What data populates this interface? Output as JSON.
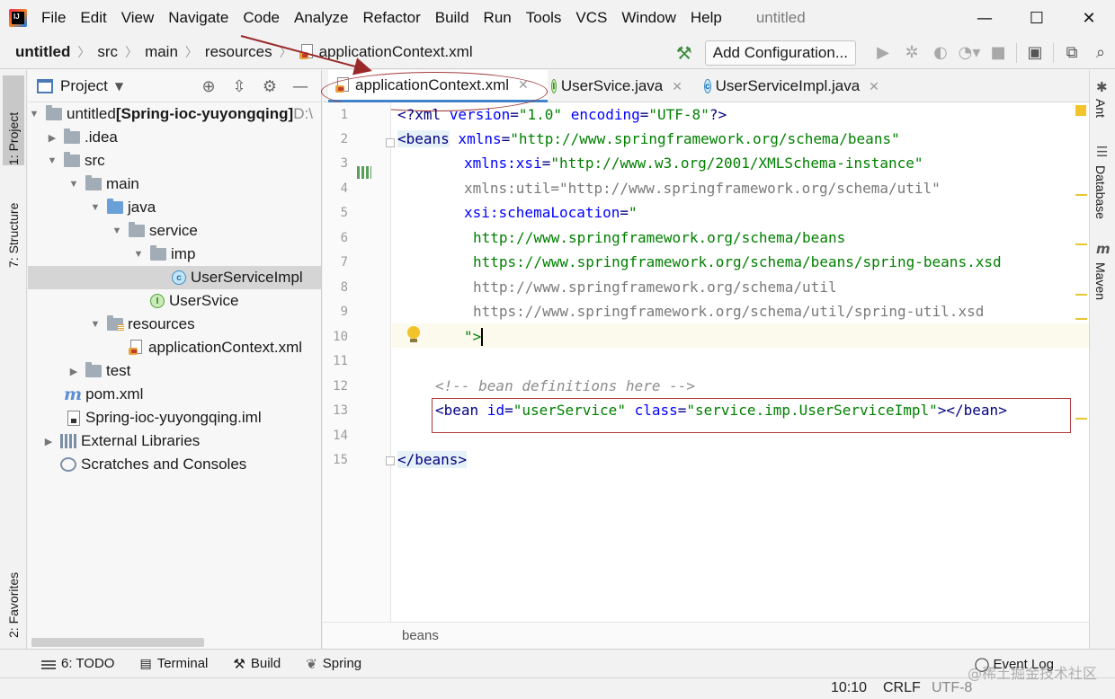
{
  "menubar": {
    "items": [
      "File",
      "Edit",
      "View",
      "Navigate",
      "Code",
      "Analyze",
      "Refactor",
      "Build",
      "Run",
      "Tools",
      "VCS",
      "Window",
      "Help"
    ],
    "window_title": "untitled",
    "minimize": "—",
    "maximize": "☐",
    "close": "✕"
  },
  "navbar": {
    "crumbs": [
      "untitled",
      "src",
      "main",
      "resources",
      "applicationContext.xml"
    ],
    "add_config": "Add Configuration..."
  },
  "left_strip": {
    "project_tab": "1: Project",
    "structure_tab": "7: Structure",
    "favorites_tab": "2: Favorites"
  },
  "project_panel": {
    "title": "Project",
    "tree": [
      {
        "label_bold": "untitled",
        "label_extra": " [Spring-ioc-yuyongqing]",
        "label_gray": " D:\\"
      },
      {
        "label": ".idea"
      },
      {
        "label": "src"
      },
      {
        "label": "main"
      },
      {
        "label": "java"
      },
      {
        "label": "service"
      },
      {
        "label": "imp"
      },
      {
        "label": "UserServiceImpl"
      },
      {
        "label": "UserSvice"
      },
      {
        "label": "resources"
      },
      {
        "label": "applicationContext.xml"
      },
      {
        "label": "test"
      },
      {
        "label": "pom.xml"
      },
      {
        "label": "Spring-ioc-yuyongqing.iml"
      },
      {
        "label": "External Libraries"
      },
      {
        "label": "Scratches and Consoles"
      }
    ]
  },
  "tabs": [
    {
      "label": "applicationContext.xml"
    },
    {
      "label": "UserSvice.java"
    },
    {
      "label": "UserServiceImpl.java"
    }
  ],
  "editor": {
    "line_numbers": [
      "1",
      "2",
      "3",
      "4",
      "5",
      "6",
      "7",
      "8",
      "9",
      "10",
      "11",
      "12",
      "13",
      "14",
      "15"
    ],
    "l1": {
      "a": "<?xml ",
      "b": "version",
      "c": "=",
      "d": "\"1.0\"",
      "e": " ",
      "f": "encoding",
      "g": "=",
      "h": "\"UTF-8\"",
      "i": "?>"
    },
    "l2": {
      "a": "<beans",
      "b": " xmlns",
      "c": "=",
      "d": "\"http://www.springframework.org/schema/beans\""
    },
    "l3": {
      "a": "xmlns:xsi",
      "b": "=",
      "c": "\"http://www.w3.org/2001/XMLSchema-instance\""
    },
    "l4": {
      "a": "xmlns:util=\"http://www.springframework.org/schema/util\""
    },
    "l5": {
      "a": "xsi:schemaLocation",
      "b": "=",
      "c": "\""
    },
    "l6": {
      "a": "http://www.springframework.org/schema/beans"
    },
    "l7": {
      "a": "https://www.springframework.org/schema/beans/spring-beans.xsd"
    },
    "l8": {
      "a": "http://www.springframework.org/schema/util"
    },
    "l9": {
      "a": "https://www.springframework.org/schema/util/spring-util.xsd"
    },
    "l10": {
      "a": "\">"
    },
    "l12": {
      "a": "<!-- bean definitions here -->"
    },
    "l13": {
      "a": "<bean",
      "b": " id",
      "c": "=",
      "d": "\"userService\"",
      "e": " class",
      "f": "=",
      "g": "\"service.imp.UserServiceImpl\"",
      "h": "></",
      "i": "bean",
      "j": ">"
    },
    "l15": {
      "a": "</beans>"
    },
    "status_crumb": "beans"
  },
  "right_strip": {
    "ant": "Ant",
    "database": "Database",
    "maven": "Maven"
  },
  "bottom_tools": {
    "todo": "6: TODO",
    "terminal": "Terminal",
    "build": "Build",
    "spring": "Spring",
    "event_log": "Event Log"
  },
  "statusbar": {
    "position": "10:10",
    "line_sep": "CRLF",
    "encoding": "UTF-8"
  },
  "watermark": "@稀土掘金技术社区"
}
